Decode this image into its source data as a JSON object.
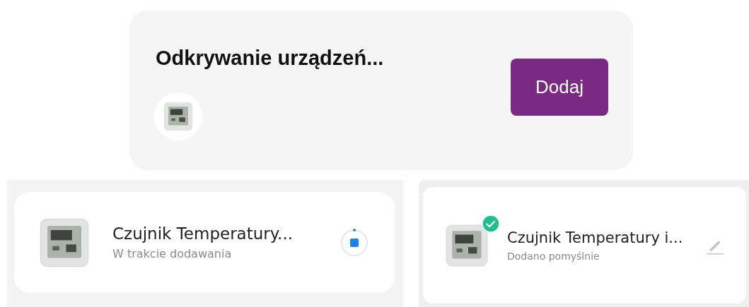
{
  "discovery": {
    "title": "Odkrywanie urządzeń...",
    "add_button": "Dodaj"
  },
  "devices": [
    {
      "kind": "adding",
      "name": "Czujnik Temperatury...",
      "status": "W trakcie dodawania"
    },
    {
      "kind": "added",
      "name": "Czujnik Temperatury i...",
      "status": "Dodano pomyślnie"
    }
  ]
}
